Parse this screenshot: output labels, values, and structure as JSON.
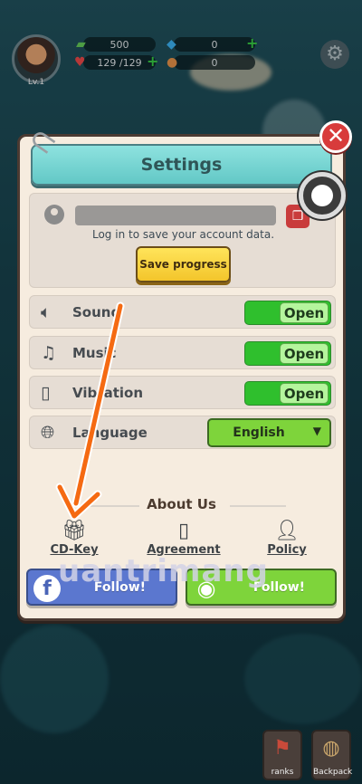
{
  "hud": {
    "level": "Lv.1",
    "cash": "500",
    "gems": "0",
    "health": "129 /129",
    "tokens": "0"
  },
  "settings": {
    "title": "Settings",
    "login_note": "Log in to save your account data.",
    "save_progress": "Save progress",
    "rows": [
      {
        "label": "Sound",
        "icon": "speaker-icon",
        "state": "Open"
      },
      {
        "label": "Music",
        "icon": "music-note-icon",
        "state": "Open"
      },
      {
        "label": "Vibration",
        "icon": "vibration-icon",
        "state": "Open"
      }
    ],
    "language_label": "Language",
    "language_value": "English",
    "about_title": "About Us",
    "about_items": [
      "CD-Key",
      "Agreement",
      "Policy"
    ],
    "follow_facebook": "Follow!",
    "follow_discord": "Follow!"
  },
  "watermark": "uantrimang",
  "bottom_nav": {
    "ranks": "ranks",
    "backpack": "Backpack"
  },
  "colors": {
    "panel_bg": "#f6ecdf",
    "header_teal": "#62c8c6",
    "toggle_green": "#2fbf2d",
    "save_yellow": "#f3c52b",
    "facebook_blue": "#5b77cf",
    "discord_green": "#7ed43b",
    "close_red": "#d83b3b",
    "annotation_arrow": "#f56a12"
  }
}
